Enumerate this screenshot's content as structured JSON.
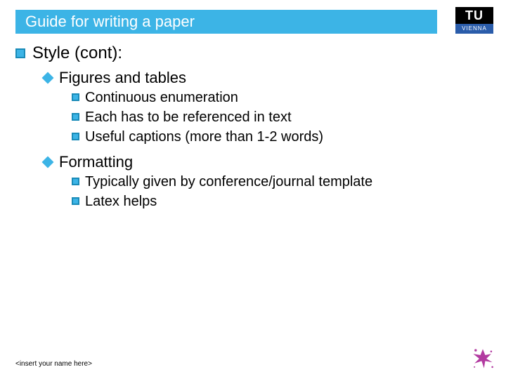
{
  "title": "Guide for writing a paper",
  "logo": {
    "top": "TU",
    "bottom": "VIENNA"
  },
  "heading": "Style (cont):",
  "sections": [
    {
      "label": "Figures and tables",
      "items": [
        "Continuous enumeration",
        "Each has to be referenced in text",
        "Useful captions (more than 1-2 words)"
      ]
    },
    {
      "label": "Formatting",
      "items": [
        "Typically given by conference/journal template",
        "Latex helps"
      ]
    }
  ],
  "footer": "<insert your name here>"
}
